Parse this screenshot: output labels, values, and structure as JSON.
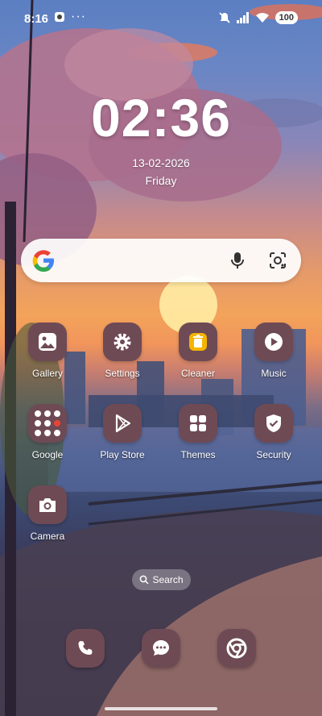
{
  "status_bar": {
    "time": "8:16",
    "more": "···",
    "battery": "100"
  },
  "clock": {
    "time": "02:36",
    "date": "13-02-2026",
    "day": "Friday"
  },
  "search_bar": {
    "logo": "google-g-icon",
    "mic": "mic-icon",
    "lens": "lens-icon"
  },
  "apps": [
    {
      "label": "Gallery",
      "icon": "gallery-icon"
    },
    {
      "label": "Settings",
      "icon": "gear-icon"
    },
    {
      "label": "Cleaner",
      "icon": "trash-icon"
    },
    {
      "label": "Music",
      "icon": "play-icon"
    },
    {
      "label": "Google",
      "icon": "google-folder-icon"
    },
    {
      "label": "Play Store",
      "icon": "play-store-icon"
    },
    {
      "label": "Themes",
      "icon": "grid-icon"
    },
    {
      "label": "Security",
      "icon": "shield-icon"
    },
    {
      "label": "Camera",
      "icon": "camera-icon"
    }
  ],
  "app_search": {
    "label": "Search"
  },
  "dock": [
    {
      "icon": "phone-icon"
    },
    {
      "icon": "chat-icon"
    },
    {
      "icon": "chrome-icon"
    }
  ],
  "colors": {
    "icon_bg": "#6e4a55",
    "cleaner_accent": "#f4b400"
  }
}
